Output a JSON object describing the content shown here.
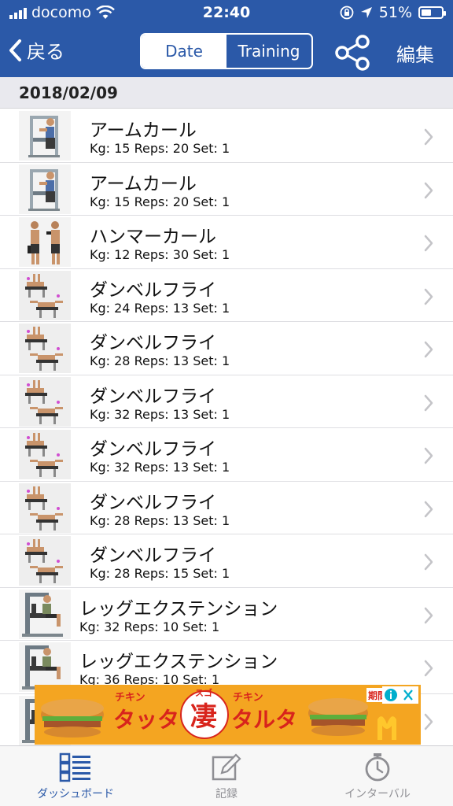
{
  "status_bar": {
    "carrier": "docomo",
    "time": "22:40",
    "battery": "51%",
    "battery_level": 0.51
  },
  "nav": {
    "back_label": "戻る",
    "segments": [
      "Date",
      "Training"
    ],
    "active_segment": "Date",
    "edit_label": "編集"
  },
  "date": "2018/02/09",
  "rows": [
    {
      "name": "アームカール",
      "detail": "Kg: 15 Reps: 20 Set: 1",
      "icon": "arm-curl-machine-icon"
    },
    {
      "name": "アームカール",
      "detail": "Kg: 15 Reps: 20 Set: 1",
      "icon": "arm-curl-machine-icon"
    },
    {
      "name": "ハンマーカール",
      "detail": "Kg: 12 Reps: 30 Set: 1",
      "icon": "hammer-curl-icon"
    },
    {
      "name": "ダンベルフライ",
      "detail": "Kg: 24 Reps: 13 Set: 1",
      "icon": "dumbbell-fly-icon"
    },
    {
      "name": "ダンベルフライ",
      "detail": "Kg: 28 Reps: 13 Set: 1",
      "icon": "dumbbell-fly-icon"
    },
    {
      "name": "ダンベルフライ",
      "detail": "Kg: 32 Reps: 13 Set: 1",
      "icon": "dumbbell-fly-icon"
    },
    {
      "name": "ダンベルフライ",
      "detail": "Kg: 32 Reps: 13 Set: 1",
      "icon": "dumbbell-fly-icon"
    },
    {
      "name": "ダンベルフライ",
      "detail": "Kg: 28 Reps: 13 Set: 1",
      "icon": "dumbbell-fly-icon"
    },
    {
      "name": "ダンベルフライ",
      "detail": "Kg: 28 Reps: 15 Set: 1",
      "icon": "dumbbell-fly-icon"
    },
    {
      "name": "レッグエクステンション",
      "detail": "Kg: 32 Reps: 10 Set: 1",
      "icon": "leg-extension-machine-icon"
    },
    {
      "name": "レッグエクステンション",
      "detail": "Kg: 36 Reps: 10 Set: 1",
      "icon": "leg-extension-machine-icon"
    },
    {
      "name": "",
      "detail": "",
      "icon": "leg-extension-machine-icon"
    }
  ],
  "ad": {
    "left_label": "チキン",
    "left_title": "タッタ",
    "center_top": "スゴ",
    "center_char": "凄",
    "right_label": "チキン",
    "right_title": "タルタ",
    "corner_label": "期間"
  },
  "tabbar": {
    "tabs": [
      "ダッシュボード",
      "記録",
      "インターバル"
    ],
    "active_tab": "ダッシュボード"
  },
  "colors": {
    "header_bg": "#2b59a8",
    "accent": "#2b59a8",
    "ad_bg": "#f4a521",
    "ad_text_red": "#d8241c",
    "mcd_yellow": "#ffc72c"
  }
}
